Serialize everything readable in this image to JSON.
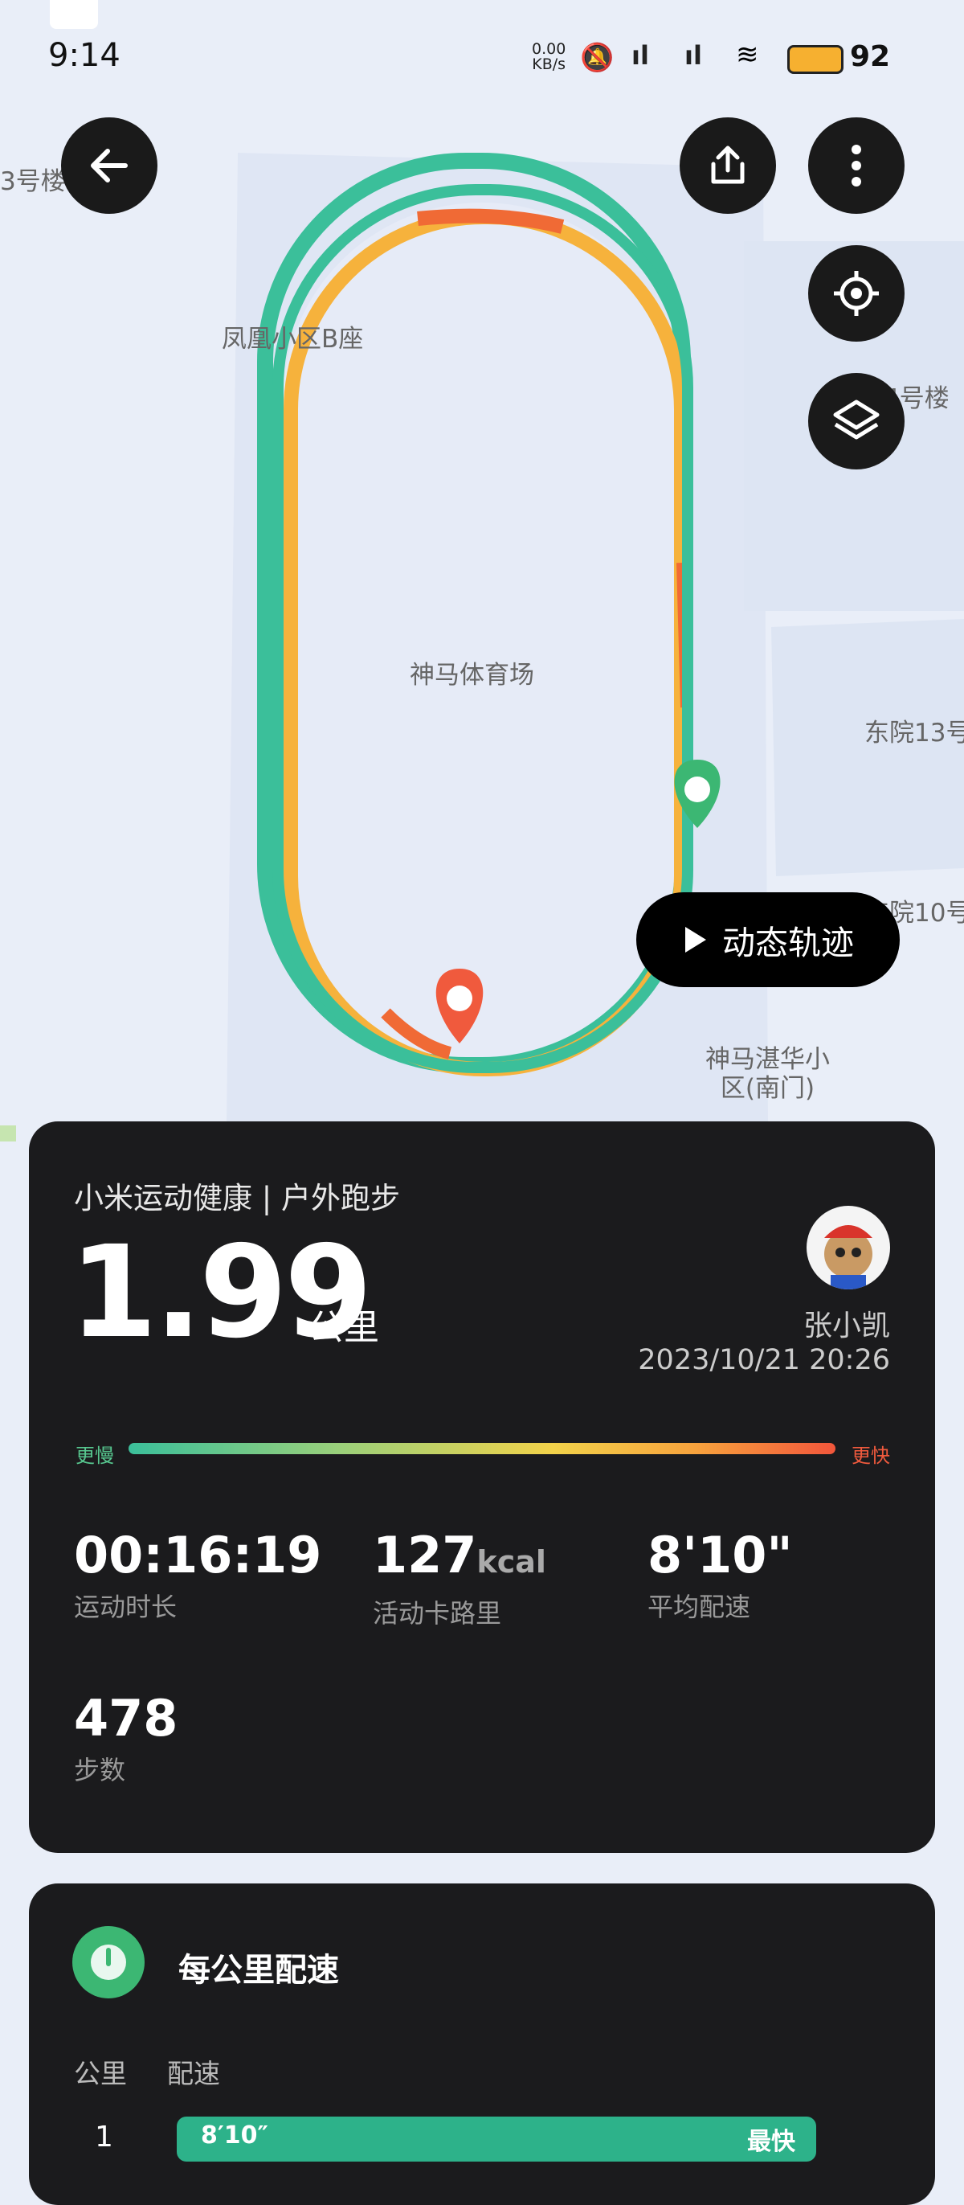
{
  "status_bar": {
    "time": "9:14",
    "net_speed": "0.00",
    "net_unit": "KB/s",
    "battery": "92"
  },
  "map": {
    "labels": {
      "b3": "3号楼",
      "b_residence": "凤凰小区B座",
      "b4": "4号楼",
      "stadium": "神马体育场",
      "east13": "东院13号",
      "east10": "东院10号",
      "south_gate": "神马湛华小\n区(南门)"
    },
    "replay_button": "动态轨迹"
  },
  "summary": {
    "app_title": "小米运动健康 | 户外跑步",
    "distance": "1.99",
    "distance_unit": "公里",
    "user_name": "张小凯",
    "date": "2023/10/21 20:26",
    "legend_slow": "更慢",
    "legend_fast": "更快",
    "colors": {
      "slow": "#3bbf9a",
      "mid": "#f2d24a",
      "fast": "#f2563b",
      "start": "#3cb773",
      "end": "#f05a3d"
    },
    "stats": {
      "duration": {
        "value": "00:16:19",
        "label": "运动时长"
      },
      "calories": {
        "value": "127",
        "unit": "kcal",
        "label": "活动卡路里"
      },
      "pace": {
        "value": "8'10\"",
        "label": "平均配速"
      },
      "steps": {
        "value": "478",
        "label": "步数"
      }
    }
  },
  "pace_section": {
    "title": "每公里配速",
    "col_km": "公里",
    "col_pace": "配速",
    "rows": [
      {
        "km": "1",
        "pace": "8′10″",
        "tag": "最快"
      }
    ]
  }
}
